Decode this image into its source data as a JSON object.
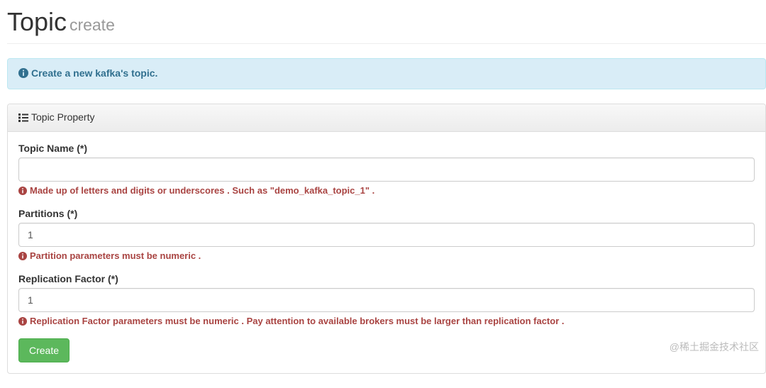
{
  "header": {
    "title": "Topic",
    "subtitle": "create"
  },
  "alert": {
    "text": "Create a new kafka's topic."
  },
  "panel": {
    "title": "Topic Property"
  },
  "fields": {
    "topicName": {
      "label": "Topic Name (*)",
      "value": "",
      "hint": "Made up of letters and digits or underscores . Such as \"demo_kafka_topic_1\" ."
    },
    "partitions": {
      "label": "Partitions (*)",
      "value": "1",
      "hint": "Partition parameters must be numeric ."
    },
    "replication": {
      "label": "Replication Factor (*)",
      "value": "1",
      "hint": "Replication Factor parameters must be numeric . Pay attention to available brokers must be larger than replication factor ."
    }
  },
  "buttons": {
    "create": "Create"
  },
  "watermark": "@稀土掘金技术社区"
}
